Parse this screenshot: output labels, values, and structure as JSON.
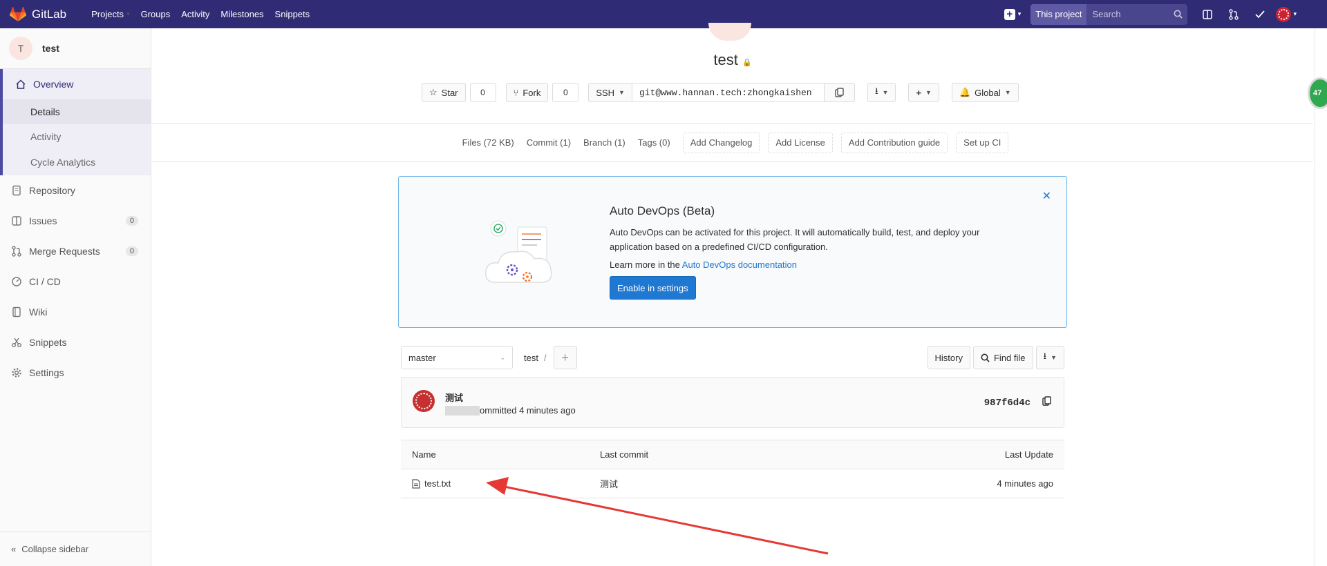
{
  "navbar": {
    "brand": "GitLab",
    "links": [
      "Projects",
      "Groups",
      "Activity",
      "Milestones",
      "Snippets"
    ],
    "search_scope": "This project",
    "search_placeholder": "Search"
  },
  "sidebar": {
    "project_initial": "T",
    "project_name": "test",
    "overview_label": "Overview",
    "overview_subitems": [
      "Details",
      "Activity",
      "Cycle Analytics"
    ],
    "items": [
      {
        "label": "Repository"
      },
      {
        "label": "Issues",
        "badge": "0"
      },
      {
        "label": "Merge Requests",
        "badge": "0"
      },
      {
        "label": "CI / CD"
      },
      {
        "label": "Wiki"
      },
      {
        "label": "Snippets"
      },
      {
        "label": "Settings"
      }
    ],
    "collapse_label": "Collapse sidebar"
  },
  "project": {
    "title": "test",
    "star_label": "Star",
    "star_count": "0",
    "fork_label": "Fork",
    "fork_count": "0",
    "clone_protocol": "SSH",
    "clone_url": "git@www.hannan.tech:zhongkaishen",
    "notification_label": "Global"
  },
  "stats": {
    "links": [
      "Files (72 KB)",
      "Commit (1)",
      "Branch (1)",
      "Tags (0)"
    ],
    "buttons": [
      "Add Changelog",
      "Add License",
      "Add Contribution guide",
      "Set up CI"
    ]
  },
  "devops": {
    "title": "Auto DevOps (Beta)",
    "text": "Auto DevOps can be activated for this project. It will automatically build, test, and deploy your application based on a predefined CI/CD configuration.",
    "learn_prefix": "Learn more in the ",
    "learn_link": "Auto DevOps documentation",
    "button": "Enable in settings"
  },
  "tree": {
    "branch": "master",
    "breadcrumb": "test",
    "separator": "/",
    "history_label": "History",
    "find_file_label": "Find file"
  },
  "commit": {
    "message": "测试",
    "meta": "ommitted 4 minutes ago",
    "sha": "987f6d4c"
  },
  "files": {
    "headers": [
      "Name",
      "Last commit",
      "Last Update"
    ],
    "rows": [
      {
        "name": "test.txt",
        "last_commit": "测试",
        "last_update": "4 minutes ago"
      }
    ]
  },
  "perf_badge": "47",
  "colors": {
    "navbar": "#2f2c75",
    "accent": "#4b4ba3",
    "primary_button": "#1f78d1",
    "arrow": "#e53935"
  }
}
